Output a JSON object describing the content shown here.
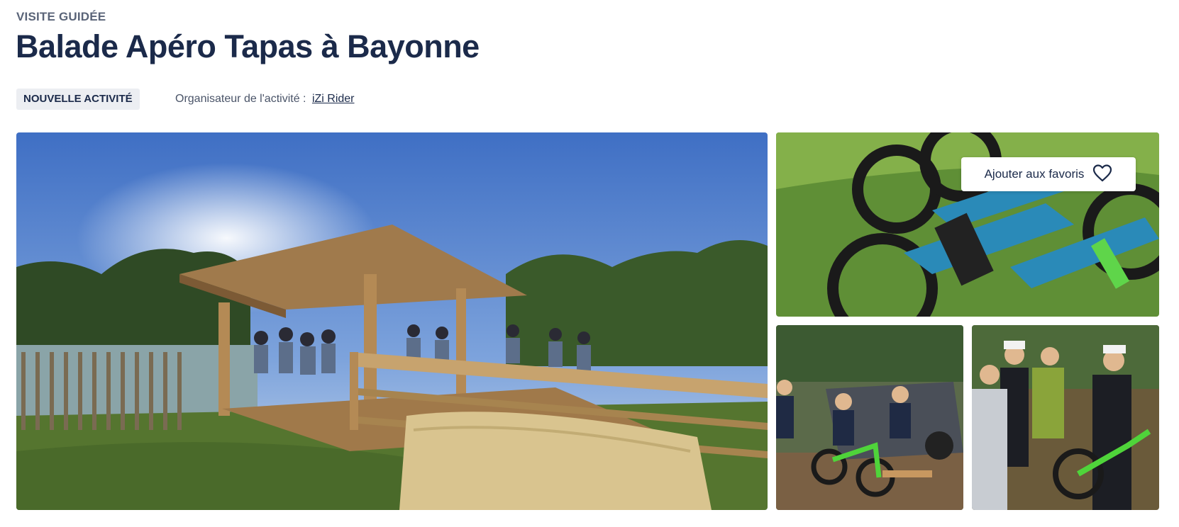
{
  "header": {
    "eyebrow": "VISITE GUIDÉE",
    "title": "Balade Apéro Tapas à Bayonne",
    "badge": "NOUVELLE ACTIVITÉ",
    "organizer_label": "Organisateur de l'activité :",
    "organizer_name": "iZi Rider"
  },
  "gallery": {
    "favorite_label": "Ajouter aux favoris",
    "favorite_icon": "heart-icon",
    "photos": [
      {
        "name": "photo-main",
        "subject": "wooden terrace with people by the river"
      },
      {
        "name": "photo-bikes",
        "subject": "blue electric bikes on grass"
      },
      {
        "name": "photo-riders",
        "subject": "riders with e-bikes near a van"
      },
      {
        "name": "photo-group",
        "subject": "group of people with bikes"
      }
    ]
  },
  "colors": {
    "text_primary": "#1b2a4a",
    "text_secondary": "#5a6478",
    "badge_bg": "#eceef2"
  }
}
